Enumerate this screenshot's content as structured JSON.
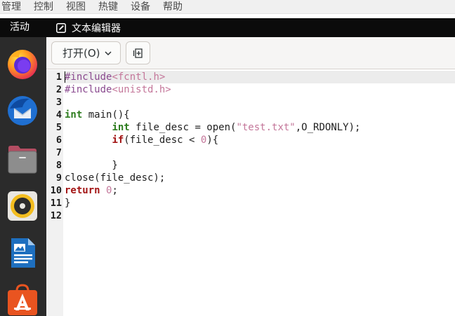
{
  "host_menu": {
    "items": [
      "管理",
      "控制",
      "视图",
      "热键",
      "设备",
      "帮助"
    ]
  },
  "top_bar": {
    "activities": "活动",
    "app_name": "文本编辑器"
  },
  "dock": {
    "items": [
      "firefox-icon",
      "thunderbird-icon",
      "files-icon",
      "rhythmbox-icon",
      "libreoffice-writer-icon",
      "software-center-icon"
    ]
  },
  "header": {
    "open_label": "打开(O)",
    "new_tab_icon": "new-tab-icon"
  },
  "editor": {
    "lines": [
      [
        {
          "t": "#include",
          "c": "pre"
        },
        {
          "t": "<fcntl.h>",
          "c": "str"
        }
      ],
      [
        {
          "t": "#include",
          "c": "pre"
        },
        {
          "t": "<unistd.h>",
          "c": "str"
        }
      ],
      [],
      [
        {
          "t": "int",
          "c": "type"
        },
        {
          "t": " main(){",
          "c": ""
        }
      ],
      [
        {
          "t": "        ",
          "c": ""
        },
        {
          "t": "int",
          "c": "type"
        },
        {
          "t": " file_desc = open(",
          "c": ""
        },
        {
          "t": "\"test.txt\"",
          "c": "str"
        },
        {
          "t": ",O_RDONLY);",
          "c": ""
        }
      ],
      [
        {
          "t": "        ",
          "c": ""
        },
        {
          "t": "if",
          "c": "kw"
        },
        {
          "t": "(file_desc < ",
          "c": ""
        },
        {
          "t": "0",
          "c": "num"
        },
        {
          "t": "){",
          "c": ""
        }
      ],
      [],
      [
        {
          "t": "        }",
          "c": ""
        }
      ],
      [
        {
          "t": "close(file_desc);",
          "c": ""
        }
      ],
      [
        {
          "t": "return",
          "c": "kw"
        },
        {
          "t": " ",
          "c": ""
        },
        {
          "t": "0",
          "c": "num"
        },
        {
          "t": ";",
          "c": ""
        }
      ],
      [
        {
          "t": "}",
          "c": ""
        }
      ],
      []
    ],
    "line_numbers": [
      "1",
      "2",
      "3",
      "4",
      "5",
      "6",
      "7",
      "8",
      "9",
      "10",
      "11",
      "12"
    ],
    "current_line": 1
  }
}
